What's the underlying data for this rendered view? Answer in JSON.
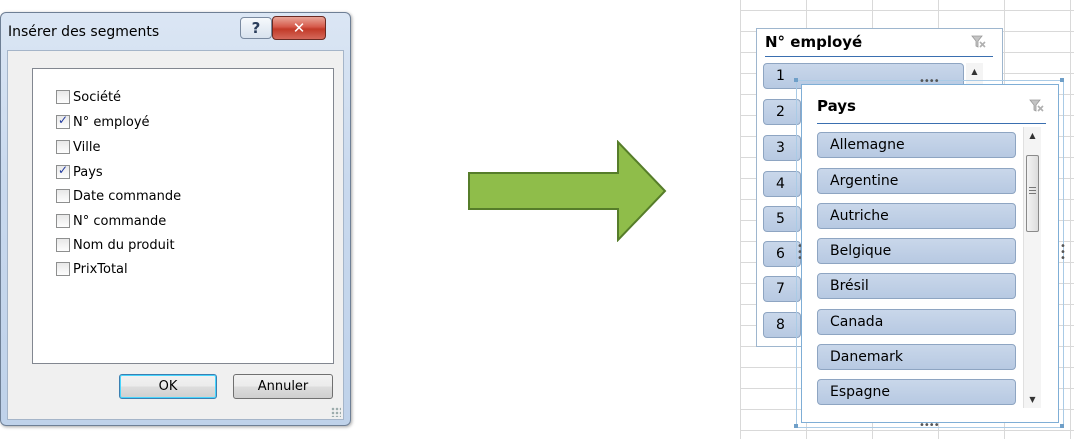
{
  "dialog": {
    "title": "Insérer des segments",
    "help_label": "?",
    "close_label": "✕",
    "fields": [
      {
        "label": "Société",
        "checked": false
      },
      {
        "label": "N° employé",
        "checked": true
      },
      {
        "label": "Ville",
        "checked": false
      },
      {
        "label": "Pays",
        "checked": true
      },
      {
        "label": "Date commande",
        "checked": false
      },
      {
        "label": "N° commande",
        "checked": false
      },
      {
        "label": "Nom du produit",
        "checked": false
      },
      {
        "label": "PrixTotal",
        "checked": false
      }
    ],
    "ok_label": "OK",
    "cancel_label": "Annuler"
  },
  "arrow": {
    "color": "#8fbd4a",
    "border_color": "#567d2a"
  },
  "slicer_employee": {
    "title": "N° employé",
    "items": [
      "1",
      "2",
      "3",
      "4",
      "5",
      "6",
      "7",
      "8"
    ]
  },
  "slicer_country": {
    "title": "Pays",
    "items": [
      "Allemagne",
      "Argentine",
      "Autriche",
      "Belgique",
      "Brésil",
      "Canada",
      "Danemark",
      "Espagne"
    ]
  },
  "colors": {
    "slicer_item": "#b8cae3",
    "slicer_border": "#8ea5c2",
    "header_line": "#3a6fb0"
  }
}
